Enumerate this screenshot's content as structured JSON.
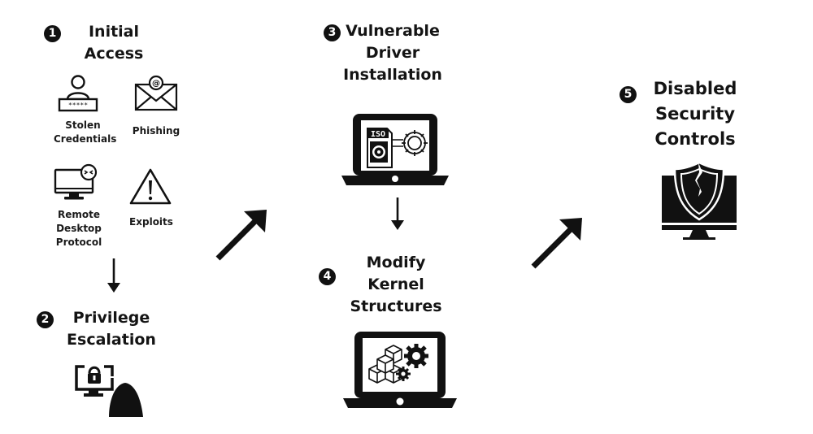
{
  "steps": [
    {
      "number": "1",
      "title_lines": [
        "Initial",
        "Access"
      ]
    },
    {
      "number": "2",
      "title_lines": [
        "Privilege",
        "Escalation"
      ]
    },
    {
      "number": "3",
      "title_lines": [
        "Vulnerable",
        "Driver",
        "Installation"
      ]
    },
    {
      "number": "4",
      "title_lines": [
        "Modify",
        "Kernel",
        "Structures"
      ]
    },
    {
      "number": "5",
      "title_lines": [
        "Disabled",
        "Security",
        "Controls"
      ]
    }
  ],
  "initial_access_methods": [
    {
      "icon": "user-password-icon",
      "label_lines": [
        "Stolen",
        "Credentials"
      ]
    },
    {
      "icon": "email-at-icon",
      "label_lines": [
        "Phishing"
      ]
    },
    {
      "icon": "remote-desktop-icon",
      "label_lines": [
        "Remote",
        "Desktop",
        "Protocol"
      ]
    },
    {
      "icon": "warning-triangle-icon",
      "label_lines": [
        "Exploits"
      ]
    }
  ],
  "icons": {
    "step2": "unlocked-monitor-hacker-icon",
    "step3": "laptop-iso-gear-icon",
    "step4": "laptop-cubes-gears-icon",
    "step5": "monitor-cracked-shield-icon"
  },
  "password_mask": "*****",
  "iso_label": "ISO"
}
